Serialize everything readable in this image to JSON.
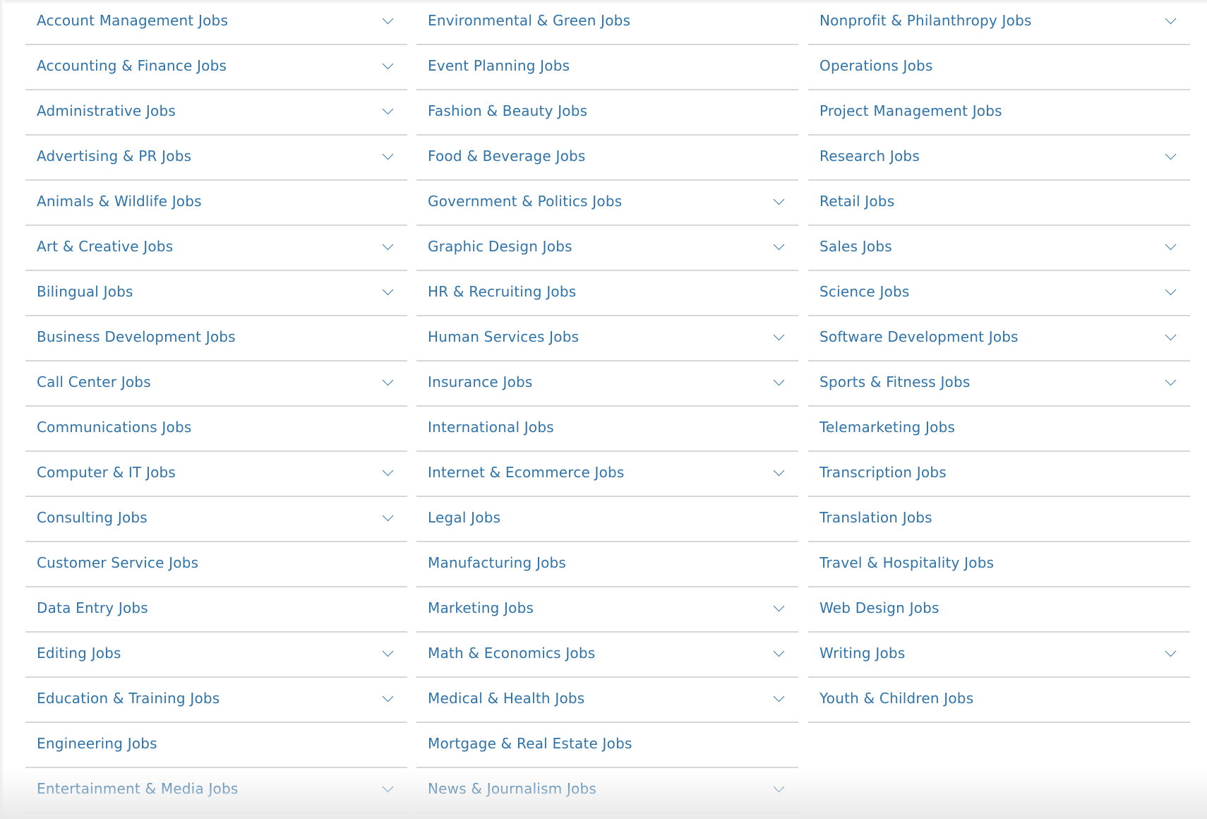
{
  "accent_color": "#2f73a8",
  "columns": [
    [
      {
        "label": "Account Management Jobs",
        "expandable": true
      },
      {
        "label": "Accounting & Finance Jobs",
        "expandable": true
      },
      {
        "label": "Administrative Jobs",
        "expandable": true
      },
      {
        "label": "Advertising & PR Jobs",
        "expandable": true
      },
      {
        "label": "Animals & Wildlife Jobs",
        "expandable": false
      },
      {
        "label": "Art & Creative Jobs",
        "expandable": true
      },
      {
        "label": "Bilingual Jobs",
        "expandable": true
      },
      {
        "label": "Business Development Jobs",
        "expandable": false
      },
      {
        "label": "Call Center Jobs",
        "expandable": true
      },
      {
        "label": "Communications Jobs",
        "expandable": false
      },
      {
        "label": "Computer & IT Jobs",
        "expandable": true
      },
      {
        "label": "Consulting Jobs",
        "expandable": true
      },
      {
        "label": "Customer Service Jobs",
        "expandable": false
      },
      {
        "label": "Data Entry Jobs",
        "expandable": false
      },
      {
        "label": "Editing Jobs",
        "expandable": true
      },
      {
        "label": "Education & Training Jobs",
        "expandable": true
      },
      {
        "label": "Engineering Jobs",
        "expandable": false
      },
      {
        "label": "Entertainment & Media Jobs",
        "expandable": true
      }
    ],
    [
      {
        "label": "Environmental & Green Jobs",
        "expandable": false
      },
      {
        "label": "Event Planning Jobs",
        "expandable": false
      },
      {
        "label": "Fashion & Beauty Jobs",
        "expandable": false
      },
      {
        "label": "Food & Beverage Jobs",
        "expandable": false
      },
      {
        "label": "Government & Politics Jobs",
        "expandable": true
      },
      {
        "label": "Graphic Design Jobs",
        "expandable": true
      },
      {
        "label": "HR & Recruiting Jobs",
        "expandable": false
      },
      {
        "label": "Human Services Jobs",
        "expandable": true
      },
      {
        "label": "Insurance Jobs",
        "expandable": true
      },
      {
        "label": "International Jobs",
        "expandable": false
      },
      {
        "label": "Internet & Ecommerce Jobs",
        "expandable": true
      },
      {
        "label": "Legal Jobs",
        "expandable": false
      },
      {
        "label": "Manufacturing Jobs",
        "expandable": false
      },
      {
        "label": "Marketing Jobs",
        "expandable": true
      },
      {
        "label": "Math & Economics Jobs",
        "expandable": true
      },
      {
        "label": "Medical & Health Jobs",
        "expandable": true
      },
      {
        "label": "Mortgage & Real Estate Jobs",
        "expandable": false
      },
      {
        "label": "News & Journalism Jobs",
        "expandable": true
      }
    ],
    [
      {
        "label": "Nonprofit & Philanthropy Jobs",
        "expandable": true
      },
      {
        "label": "Operations Jobs",
        "expandable": false
      },
      {
        "label": "Project Management Jobs",
        "expandable": false
      },
      {
        "label": "Research Jobs",
        "expandable": true
      },
      {
        "label": "Retail Jobs",
        "expandable": false
      },
      {
        "label": "Sales Jobs",
        "expandable": true
      },
      {
        "label": "Science Jobs",
        "expandable": true
      },
      {
        "label": "Software Development Jobs",
        "expandable": true
      },
      {
        "label": "Sports & Fitness Jobs",
        "expandable": true
      },
      {
        "label": "Telemarketing Jobs",
        "expandable": false
      },
      {
        "label": "Transcription Jobs",
        "expandable": false
      },
      {
        "label": "Translation Jobs",
        "expandable": false
      },
      {
        "label": "Travel & Hospitality Jobs",
        "expandable": false
      },
      {
        "label": "Web Design Jobs",
        "expandable": false
      },
      {
        "label": "Writing Jobs",
        "expandable": true
      },
      {
        "label": "Youth & Children Jobs",
        "expandable": false
      }
    ]
  ]
}
